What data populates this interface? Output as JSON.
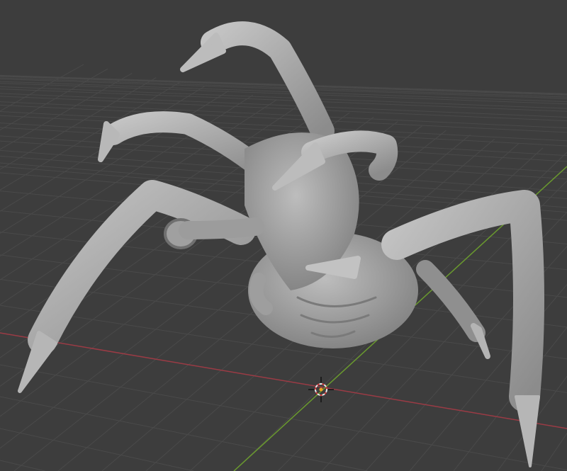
{
  "viewport": {
    "background_color": "#3d3d3d",
    "grid_color": "#4a4a4a",
    "x_axis_color": "#9b3b45",
    "y_axis_color": "#6a9a2e",
    "model_color": "#a9a9a9",
    "model_shadow_color": "#6f6f6f",
    "cursor_icon": "3d-cursor-icon"
  }
}
